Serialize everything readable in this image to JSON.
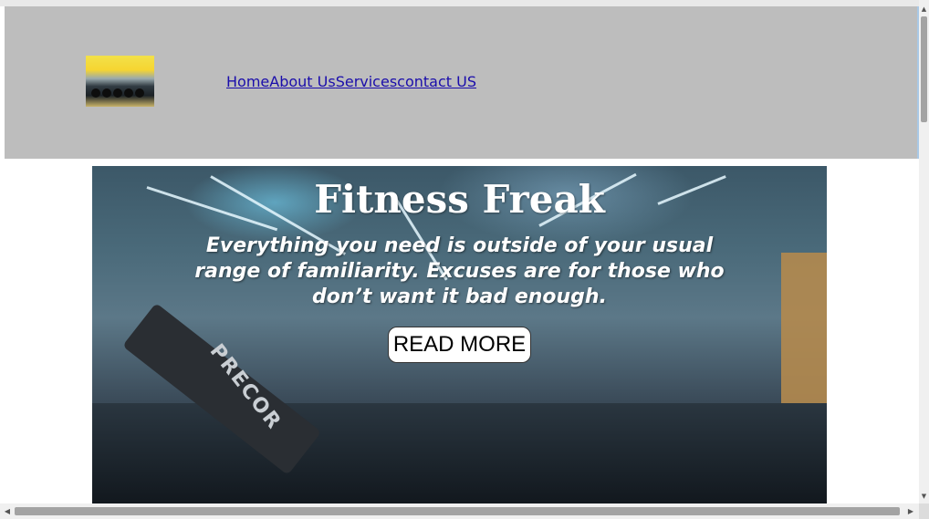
{
  "header": {
    "logo_alt": "kettlebell rack logo",
    "nav": [
      {
        "label": "Home"
      },
      {
        "label": "About Us"
      },
      {
        "label": "Services"
      },
      {
        "label": "contact US"
      }
    ]
  },
  "hero": {
    "title": "Fitness Freak",
    "tagline": "Everything you need is outside of your usual range of familiarity. Excuses are for those who don’t want it bad enough.",
    "button_label": "READ MORE",
    "equipment_label": "PRECOR"
  },
  "scrollbars": {
    "up_arrow": "▲",
    "down_arrow": "▼",
    "left_arrow": "◀",
    "right_arrow": "▶"
  },
  "colors": {
    "header_bg": "#bdbdbd",
    "link": "#1a0dab",
    "button_bg": "#ffffff"
  }
}
